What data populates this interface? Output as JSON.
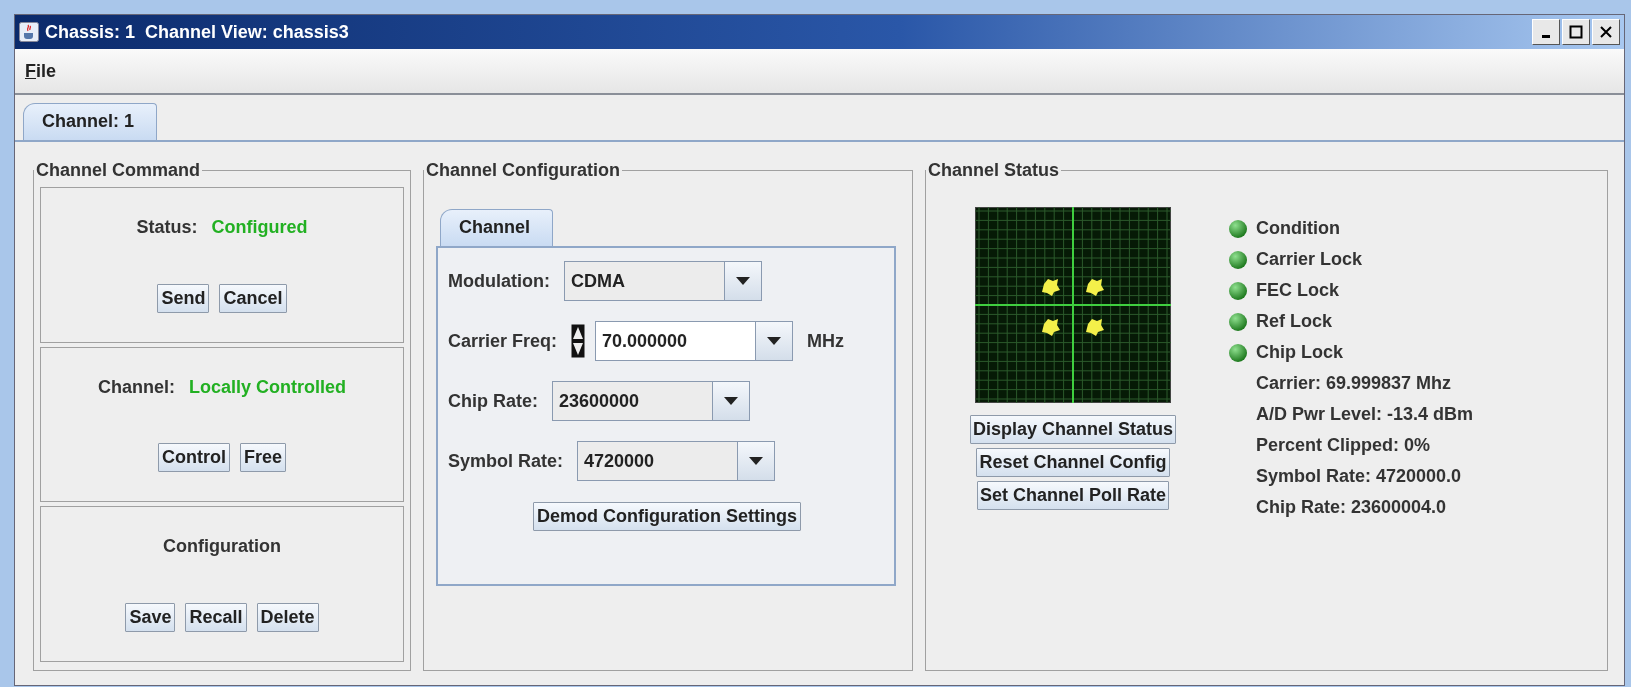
{
  "window": {
    "title": "Chassis: 1  Channel View: chassis3"
  },
  "menu": [
    {
      "label": "File"
    }
  ],
  "tabs": [
    {
      "label": "Channel: 1",
      "selected": true
    }
  ],
  "channel_command": {
    "title": "Channel Command",
    "sections": [
      {
        "label": "Status:",
        "value": "Configured",
        "buttons": [
          "Send",
          "Cancel"
        ]
      },
      {
        "label": "Channel:",
        "value": "Locally Controlled",
        "buttons": [
          "Control",
          "Free"
        ]
      },
      {
        "label": "Configuration",
        "buttons": [
          "Save",
          "Recall",
          "Delete"
        ]
      }
    ]
  },
  "channel_configuration": {
    "title": "Channel Configuration",
    "tabs": [
      {
        "label": "Channel",
        "selected": true
      }
    ],
    "fields": [
      {
        "label": "Modulation:",
        "value": "CDMA",
        "editable": false,
        "spinner": false
      },
      {
        "label": "Carrier Freq:",
        "value": "70.000000",
        "editable": true,
        "spinner": true,
        "unit": "MHz"
      },
      {
        "label": "Chip Rate:",
        "value": "23600000",
        "editable": false,
        "spinner": false
      },
      {
        "label": "Symbol Rate:",
        "value": "4720000",
        "editable": false,
        "spinner": false
      }
    ],
    "button": "Demod Configuration Settings"
  },
  "channel_status": {
    "title": "Channel Status",
    "buttons": [
      "Display Channel Status",
      "Reset Channel Config",
      "Set Channel Poll Rate"
    ],
    "indicators": [
      {
        "label": "Condition",
        "on": true
      },
      {
        "label": "Carrier Lock",
        "on": true
      },
      {
        "label": "FEC Lock",
        "on": true
      },
      {
        "label": "Ref Lock",
        "on": true
      },
      {
        "label": "Chip Lock",
        "on": true
      }
    ],
    "readings": [
      "Carrier: 69.999837 Mhz",
      "A/D Pwr Level: -13.4 dBm",
      "Percent Clipped: 0%",
      "Symbol Rate: 4720000.0",
      "Chip Rate: 23600004.0"
    ]
  }
}
